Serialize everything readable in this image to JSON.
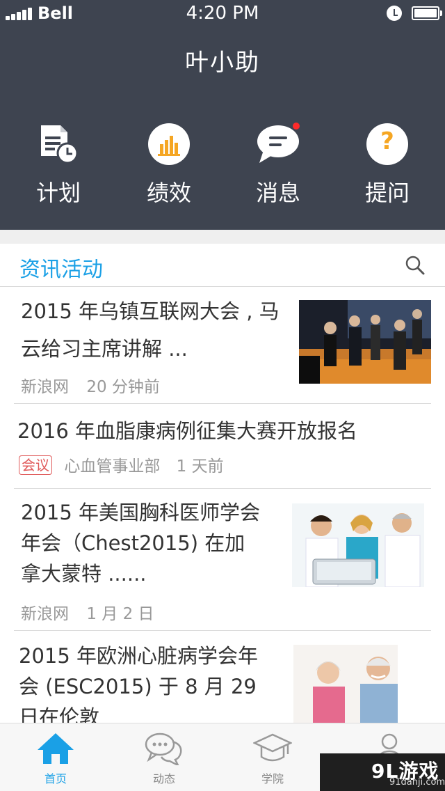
{
  "status_bar": {
    "carrier": "Bell",
    "time": "4:20 PM"
  },
  "app": {
    "title": "叶小助"
  },
  "quick_actions": [
    {
      "label": "计划",
      "icon": "plan-document-clock-icon"
    },
    {
      "label": "绩效",
      "icon": "bar-chart-icon"
    },
    {
      "label": "消息",
      "icon": "message-bubble-icon",
      "badge": true
    },
    {
      "label": "提问",
      "icon": "question-icon"
    }
  ],
  "section": {
    "title": "资讯活动",
    "search_icon": "search-icon"
  },
  "news": [
    {
      "title_line1": "2015 年乌镇互联网大会 , 马",
      "title_line2": "云给习主席讲解 ...",
      "source": "新浪网",
      "time": "20 分钟前"
    },
    {
      "title_line1": "2016 年血脂康病例征集大赛开放报名",
      "tag": "会议",
      "source": "心血管事业部",
      "time": "1 天前"
    },
    {
      "title_line1": "2015 年美国胸科医师学会",
      "title_line2": "年会（Chest2015) 在加",
      "title_line3": "拿大蒙特 ......",
      "source": "新浪网",
      "time": "1 月 2 日"
    },
    {
      "title_line1": "2015 年欧洲心脏病学会年",
      "title_line2": "会 (ESC2015) 于 8 月 29",
      "title_line3": "日在伦敦"
    }
  ],
  "tabs": [
    {
      "label": "首页",
      "icon": "home-icon",
      "active": true
    },
    {
      "label": "动态",
      "icon": "chat-bubbles-icon"
    },
    {
      "label": "学院",
      "icon": "graduation-cap-icon"
    },
    {
      "label": "",
      "icon": "user-icon"
    }
  ],
  "watermark": {
    "main": "9L游戏",
    "sub": "91danji.com"
  },
  "colors": {
    "header_bg": "#3e4450",
    "accent": "#1aa0e6",
    "icon_orange": "#f5a623",
    "badge_red": "#ff2a2a"
  }
}
